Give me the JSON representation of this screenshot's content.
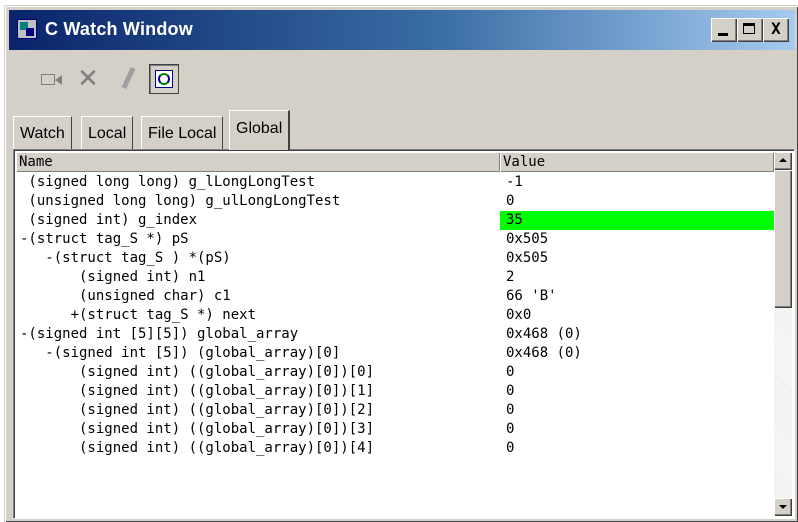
{
  "window": {
    "title": "C Watch Window",
    "buttons": {
      "minimize": "_",
      "maximize": "□",
      "close": "X"
    }
  },
  "toolbar": {
    "icons": [
      "add-watch-icon",
      "delete-icon",
      "edit-icon",
      "refresh-icon"
    ],
    "delete_glyph": "✕"
  },
  "tabs": [
    {
      "label": "Watch",
      "active": false
    },
    {
      "label": "Local",
      "active": false
    },
    {
      "label": "File Local",
      "active": false
    },
    {
      "label": "Global",
      "active": true
    }
  ],
  "columns": {
    "name": "Name",
    "value": "Value"
  },
  "rows": [
    {
      "name": " (signed long long) g_lLongLongTest",
      "value": "-1",
      "highlight": false
    },
    {
      "name": " (unsigned long long) g_ulLongLongTest",
      "value": "0",
      "highlight": false
    },
    {
      "name": " (signed int) g_index",
      "value": "35",
      "highlight": true
    },
    {
      "name": "-(struct tag_S *) pS",
      "value": "0x505",
      "highlight": false
    },
    {
      "name": "   -(struct tag_S ) *(pS)",
      "value": "0x505",
      "highlight": false
    },
    {
      "name": "       (signed int) n1",
      "value": "2",
      "highlight": false
    },
    {
      "name": "       (unsigned char) c1",
      "value": "66 'B'",
      "highlight": false
    },
    {
      "name": "      +(struct tag_S *) next",
      "value": "0x0",
      "highlight": false
    },
    {
      "name": "-(signed int [5][5]) global_array",
      "value": "0x468 (0)",
      "highlight": false
    },
    {
      "name": "   -(signed int [5]) (global_array)[0]",
      "value": "0x468 (0)",
      "highlight": false
    },
    {
      "name": "       (signed int) ((global_array)[0])[0]",
      "value": "0",
      "highlight": false
    },
    {
      "name": "       (signed int) ((global_array)[0])[1]",
      "value": "0",
      "highlight": false
    },
    {
      "name": "       (signed int) ((global_array)[0])[2]",
      "value": "0",
      "highlight": false
    },
    {
      "name": "       (signed int) ((global_array)[0])[3]",
      "value": "0",
      "highlight": false
    },
    {
      "name": "       (signed int) ((global_array)[0])[4]",
      "value": "0",
      "highlight": false
    }
  ],
  "colors": {
    "highlight": "#00ff00",
    "titlebar": "#0a246a",
    "face": "#d4d0c8"
  },
  "scroll": {
    "thumb_fraction": 0.42,
    "position_fraction": 0.0
  }
}
